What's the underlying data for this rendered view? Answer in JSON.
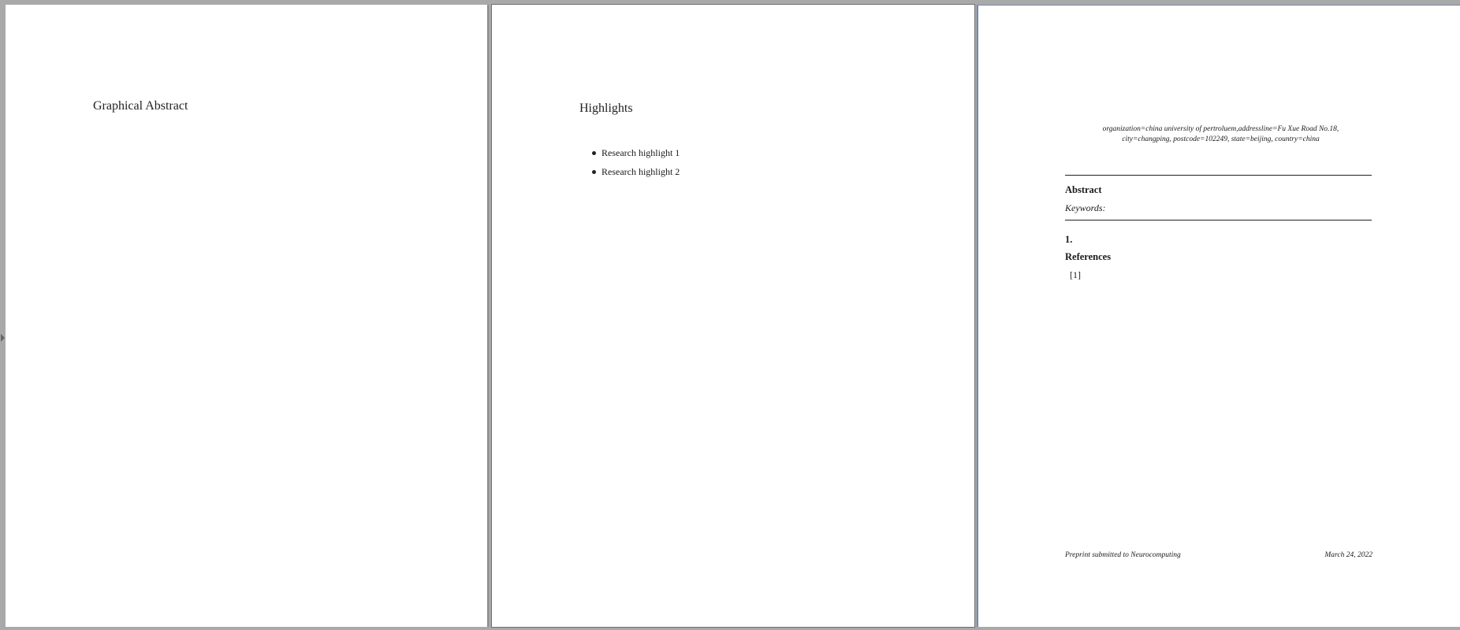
{
  "pages": {
    "page1": {
      "title": "Graphical Abstract"
    },
    "page2": {
      "title": "Highlights",
      "highlights": [
        "Research highlight 1",
        "Research highlight 2"
      ]
    },
    "page3": {
      "affiliation_line1": "organization=china university of pertroluem,addressline=Fu Xue Road No.18,",
      "affiliation_line2": "city=changping, postcode=102249, state=beijing, country=china",
      "abstract_label": "Abstract",
      "keywords_label": "Keywords:",
      "section_number": "1.",
      "references_label": "References",
      "reference_1": "[1]",
      "footer_left": "Preprint submitted to Neurocomputing",
      "footer_right": "March 24, 2022"
    }
  }
}
